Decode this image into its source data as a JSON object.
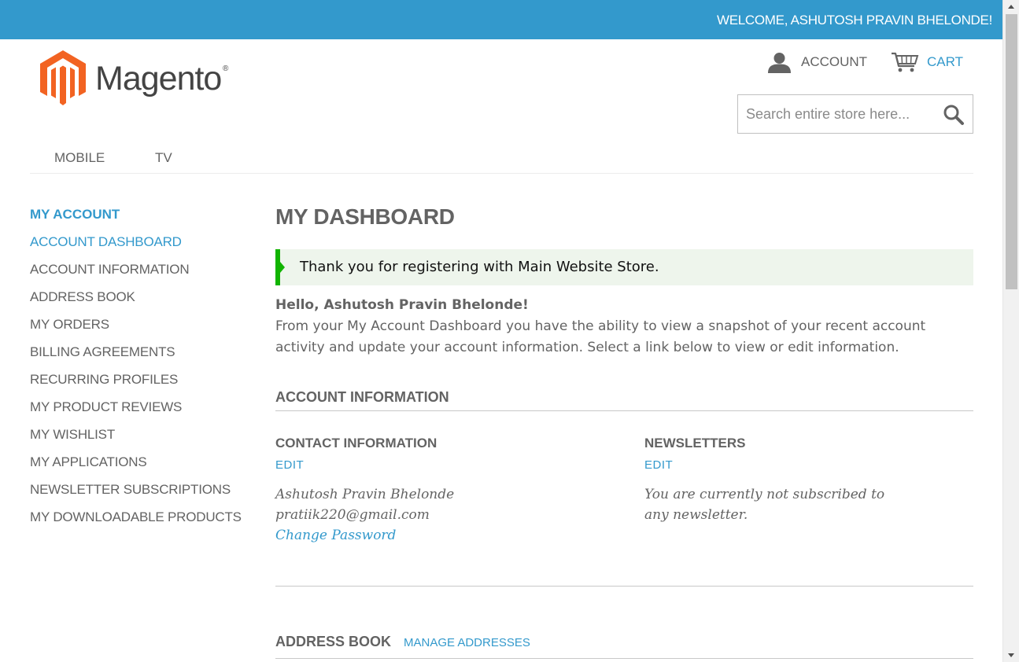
{
  "header": {
    "welcome": "WELCOME, ASHUTOSH PRAVIN BHELONDE!",
    "logo_text": "Magento",
    "logo_reg": "®",
    "account_label": "ACCOUNT",
    "cart_label": "CART",
    "search_placeholder": "Search entire store here..."
  },
  "nav": {
    "items": [
      "MOBILE",
      "TV"
    ]
  },
  "sidebar": {
    "title": "MY ACCOUNT",
    "items": [
      "ACCOUNT DASHBOARD",
      "ACCOUNT INFORMATION",
      "ADDRESS BOOK",
      "MY ORDERS",
      "BILLING AGREEMENTS",
      "RECURRING PROFILES",
      "MY PRODUCT REVIEWS",
      "MY WISHLIST",
      "MY APPLICATIONS",
      "NEWSLETTER SUBSCRIPTIONS",
      "MY DOWNLOADABLE PRODUCTS"
    ],
    "active_index": 0
  },
  "main": {
    "title": "MY DASHBOARD",
    "success_message": "Thank you for registering with Main Website Store.",
    "hello": "Hello, Ashutosh Pravin Bhelonde!",
    "intro": "From your My Account Dashboard you have the ability to view a snapshot of your recent account activity and update your account information. Select a link below to view or edit information.",
    "account_info": {
      "title": "ACCOUNT INFORMATION",
      "contact": {
        "title": "CONTACT INFORMATION",
        "edit": "EDIT",
        "name": "Ashutosh Pravin Bhelonde",
        "email": "pratiik220@gmail.com",
        "change_password": "Change Password"
      },
      "newsletters": {
        "title": "NEWSLETTERS",
        "edit": "EDIT",
        "text": "You are currently not subscribed to any newsletter."
      }
    },
    "address_book": {
      "title": "ADDRESS BOOK",
      "manage": "MANAGE ADDRESSES"
    }
  },
  "colors": {
    "brand_blue": "#3399cc",
    "success_green": "#11b400",
    "logo_orange": "#f26322"
  }
}
